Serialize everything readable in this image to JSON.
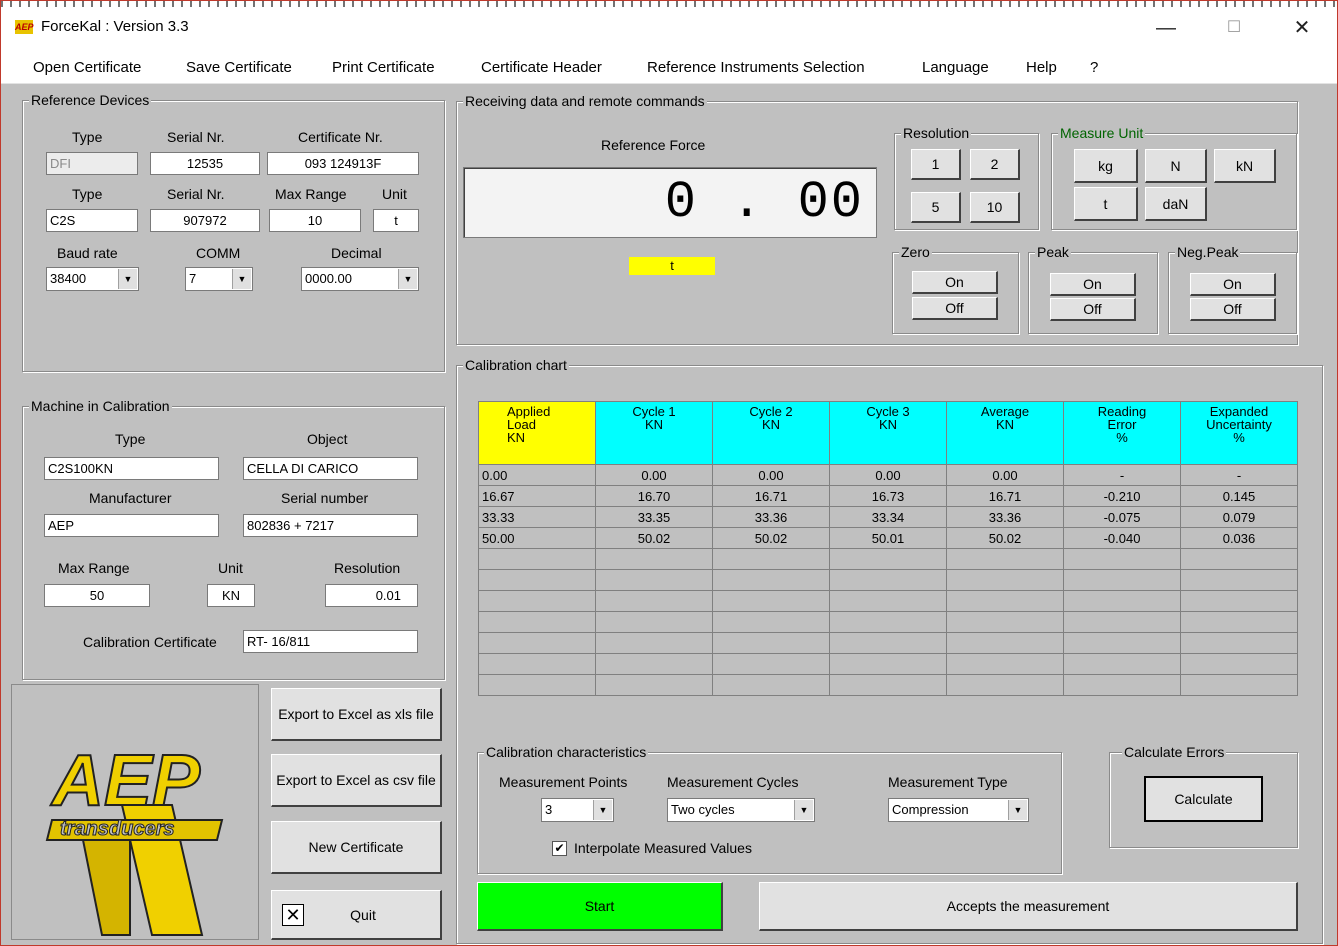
{
  "window": {
    "title": "ForceKal : Version 3.3",
    "minimize": "—",
    "maximize": "☐",
    "close": "✕"
  },
  "menu": [
    "Open Certificate",
    "Save Certificate",
    "Print Certificate",
    "Certificate Header",
    "Reference Instruments Selection",
    "Language",
    "Help",
    "?"
  ],
  "reference": {
    "group_label": "Reference Devices",
    "type_label": "Type",
    "serial_label": "Serial Nr.",
    "cert_label": "Certificate Nr.",
    "type1": "DFI",
    "serial1": "12535",
    "cert1": "093 124913F",
    "type2_label": "Type",
    "serial2_label": "Serial Nr.",
    "maxrange_label": "Max Range",
    "unit_label": "Unit",
    "type2": "C2S",
    "serial2": "907972",
    "maxrange": "10",
    "unit": "t",
    "baud_label": "Baud rate",
    "comm_label": "COMM",
    "decimal_label": "Decimal",
    "baud": "38400",
    "comm": "7",
    "decimal": "0000.00"
  },
  "machine": {
    "group_label": "Machine in Calibration",
    "type_label": "Type",
    "object_label": "Object",
    "type": "C2S100KN",
    "object": "CELLA DI CARICO",
    "manufacturer_label": "Manufacturer",
    "serial_label": "Serial number",
    "manufacturer": "AEP",
    "serial": "802836 + 7217",
    "maxrange_label": "Max Range",
    "unit_label": "Unit",
    "resolution_label": "Resolution",
    "maxrange": "50",
    "unit": "KN",
    "resolution": "0.01",
    "cert_label": "Calibration Certificate",
    "cert": "RT- 16/811"
  },
  "logo": {
    "brand": "AEP",
    "tagline": "transducers"
  },
  "actions": {
    "export_xls": "Export to Excel as xls file",
    "export_csv": "Export to Excel as csv file",
    "new_cert": "New Certificate",
    "quit": "Quit"
  },
  "receiving": {
    "group_label": "Receiving data and remote commands",
    "ref_force_label": "Reference Force",
    "value": "0 . 00",
    "unit": "t",
    "resolution_label": "Resolution",
    "res_buttons": [
      "1",
      "2",
      "5",
      "10"
    ],
    "unit_group_label": "Measure Unit",
    "unit_buttons": [
      "kg",
      "N",
      "kN",
      "t",
      "daN"
    ],
    "zero_label": "Zero",
    "peak_label": "Peak",
    "negpeak_label": "Neg.Peak",
    "on": "On",
    "off": "Off"
  },
  "calibration": {
    "group_label": "Calibration chart",
    "headers": [
      [
        "Applied",
        "Load",
        "KN"
      ],
      [
        "Cycle 1",
        "KN"
      ],
      [
        "Cycle 2",
        "KN"
      ],
      [
        "Cycle 3",
        "KN"
      ],
      [
        "Average",
        "KN"
      ],
      [
        "Reading",
        "Error",
        "%"
      ],
      [
        "Expanded",
        "Uncertainty",
        "%"
      ]
    ],
    "rows": [
      [
        "0.00",
        "0.00",
        "0.00",
        "0.00",
        "0.00",
        "-",
        "-"
      ],
      [
        "16.67",
        "16.70",
        "16.71",
        "16.73",
        "16.71",
        "-0.210",
        "0.145"
      ],
      [
        "33.33",
        "33.35",
        "33.36",
        "33.34",
        "33.36",
        "-0.075",
        "0.079"
      ],
      [
        "50.00",
        "50.02",
        "50.02",
        "50.01",
        "50.02",
        "-0.040",
        "0.036"
      ],
      [
        "",
        "",
        "",
        "",
        "",
        "",
        ""
      ],
      [
        "",
        "",
        "",
        "",
        "",
        "",
        ""
      ],
      [
        "",
        "",
        "",
        "",
        "",
        "",
        ""
      ],
      [
        "",
        "",
        "",
        "",
        "",
        "",
        ""
      ],
      [
        "",
        "",
        "",
        "",
        "",
        "",
        ""
      ],
      [
        "",
        "",
        "",
        "",
        "",
        "",
        ""
      ],
      [
        "",
        "",
        "",
        "",
        "",
        "",
        ""
      ]
    ]
  },
  "characteristics": {
    "group_label": "Calibration characteristics",
    "points_label": "Measurement Points",
    "cycles_label": "Measurement Cycles",
    "type_label": "Measurement Type",
    "points": "3",
    "cycles": "Two cycles",
    "type": "Compression",
    "interpolate_label": "Interpolate Measured Values",
    "interpolate_mark": "✔"
  },
  "errors": {
    "group_label": "Calculate Errors",
    "calculate": "Calculate"
  },
  "bottom": {
    "start": "Start",
    "accept": "Accepts the measurement"
  },
  "colors": {
    "start_green": "#00ff00",
    "header_cyan": "#00ffff",
    "header_yellow": "#ffff00"
  }
}
